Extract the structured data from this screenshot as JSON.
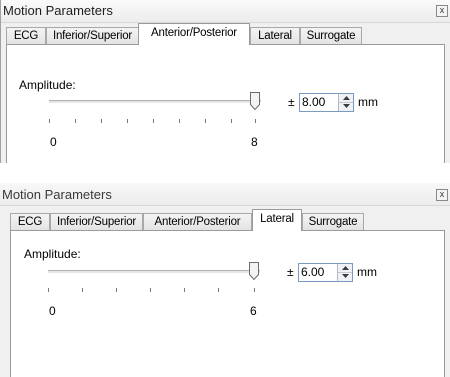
{
  "panels": [
    {
      "title": "Motion Parameters",
      "close_glyph": "x",
      "tabs": [
        {
          "label": "ECG",
          "active": false
        },
        {
          "label": "Inferior/Superior",
          "active": false
        },
        {
          "label": "Anterior/Posterior",
          "active": true
        },
        {
          "label": "Lateral",
          "active": false
        },
        {
          "label": "Surrogate",
          "active": false
        }
      ],
      "amplitude": {
        "label": "Amplitude:",
        "slider_min_label": "0",
        "slider_max_label": "8",
        "slider_fraction": 1.0,
        "plus_minus": "±",
        "value": "8.00",
        "unit": "mm"
      }
    },
    {
      "title": "Motion Parameters",
      "close_glyph": "x",
      "tabs": [
        {
          "label": "ECG",
          "active": false
        },
        {
          "label": "Inferior/Superior",
          "active": false
        },
        {
          "label": "Anterior/Posterior",
          "active": false
        },
        {
          "label": "Lateral",
          "active": true
        },
        {
          "label": "Surrogate",
          "active": false
        }
      ],
      "amplitude": {
        "label": "Amplitude:",
        "slider_min_label": "0",
        "slider_max_label": "6",
        "slider_fraction": 1.0,
        "plus_minus": "±",
        "value": "6.00",
        "unit": "mm"
      }
    }
  ],
  "icons": {
    "spin_up": "spin-up-arrow-icon",
    "spin_down": "spin-down-arrow-icon",
    "close": "close-icon"
  },
  "colors": {
    "panel_bg": "#f0f0f0",
    "tab_body_bg": "#ffffff",
    "spin_border": "#7a9ac0"
  }
}
